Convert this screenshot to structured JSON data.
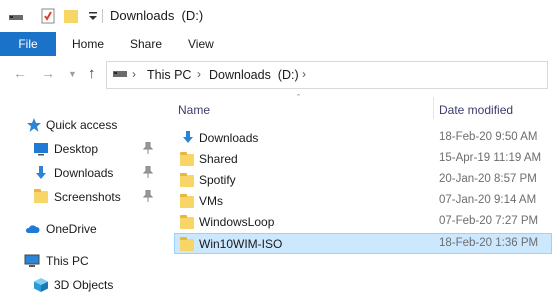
{
  "window": {
    "title": "Downloads  (D:)"
  },
  "ribbon": {
    "tabs": [
      "File",
      "Home",
      "Share",
      "View"
    ]
  },
  "address": {
    "crumbs": [
      "This PC",
      "Downloads  (D:)"
    ]
  },
  "navpane": {
    "items": [
      {
        "label": "Quick access",
        "icon": "star-icon",
        "pinned": false
      },
      {
        "label": "Desktop",
        "icon": "desktop-icon",
        "pinned": true
      },
      {
        "label": "Downloads",
        "icon": "download-arrow-icon",
        "pinned": true
      },
      {
        "label": "Screenshots",
        "icon": "folder-icon",
        "pinned": true
      },
      {
        "label": "OneDrive",
        "icon": "cloud-icon",
        "pinned": false
      },
      {
        "label": "This PC",
        "icon": "computer-icon",
        "pinned": false
      },
      {
        "label": "3D Objects",
        "icon": "cube-icon",
        "pinned": false
      }
    ]
  },
  "filelist": {
    "columns": {
      "name": "Name",
      "date": "Date modified"
    },
    "rows": [
      {
        "name": "Downloads",
        "date": "18-Feb-20 9:50 AM",
        "icon": "download-arrow-icon",
        "selected": false
      },
      {
        "name": "Shared",
        "date": "15-Apr-19 11:19 AM",
        "icon": "folder-icon",
        "selected": false
      },
      {
        "name": "Spotify",
        "date": "20-Jan-20 8:57 PM",
        "icon": "folder-icon",
        "selected": false
      },
      {
        "name": "VMs",
        "date": "07-Jan-20 9:14 AM",
        "icon": "folder-icon",
        "selected": false
      },
      {
        "name": "WindowsLoop",
        "date": "07-Feb-20 7:27 PM",
        "icon": "folder-icon",
        "selected": false
      },
      {
        "name": "Win10WIM-ISO",
        "date": "18-Feb-20 1:36 PM",
        "icon": "folder-icon",
        "selected": true
      }
    ]
  },
  "colors": {
    "accent": "#1a73c8",
    "selection": "#cce8ff",
    "folder": "#f7d566"
  }
}
